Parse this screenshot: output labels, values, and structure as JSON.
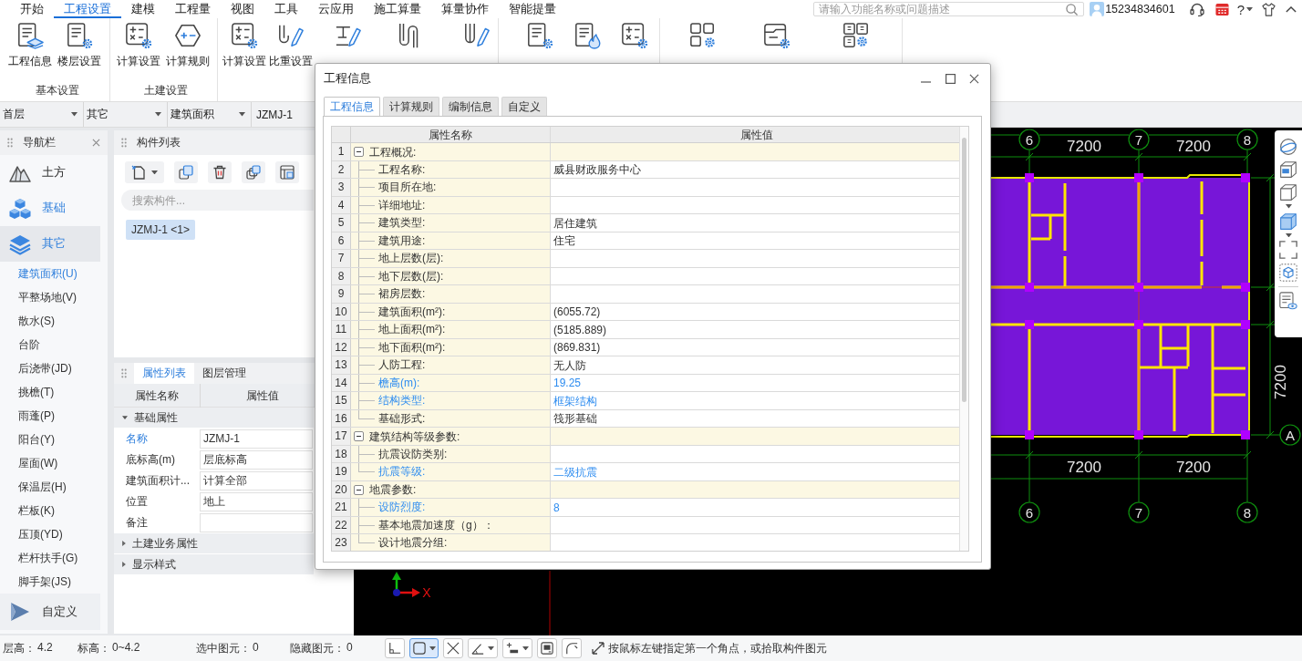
{
  "menu": {
    "tabs": [
      {
        "label": "开始",
        "selected": false
      },
      {
        "label": "工程设置",
        "selected": true
      },
      {
        "label": "建模",
        "selected": false
      },
      {
        "label": "工程量",
        "selected": false
      },
      {
        "label": "视图",
        "selected": false
      },
      {
        "label": "工具",
        "selected": false
      },
      {
        "label": "云应用",
        "selected": false
      },
      {
        "label": "施工算量",
        "selected": false
      },
      {
        "label": "算量协作",
        "selected": false
      },
      {
        "label": "智能提量",
        "selected": false
      }
    ],
    "search": {
      "placeholder": "请输入功能名称或问题描述"
    },
    "user": "15234834601",
    "help": "?"
  },
  "ribbon": {
    "groups": [
      {
        "label": "基本设置",
        "buttons": [
          "工程信息",
          "楼层设置"
        ]
      },
      {
        "label": "土建设置",
        "buttons": [
          "计算设置",
          "计算规则"
        ]
      },
      {
        "buttons": [
          "计算设置",
          "比重设置"
        ]
      }
    ]
  },
  "selectors": [
    "首层",
    "其它",
    "建筑面积"
  ],
  "current_component": "JZMJ-1",
  "navigation": {
    "title": "导航栏",
    "categories": [
      {
        "label": "土方",
        "selected": false,
        "hovered": false
      },
      {
        "label": "基础",
        "selected": false,
        "hovered": true
      },
      {
        "label": "其它",
        "selected": true,
        "hovered": false,
        "children": [
          {
            "label": "建筑面积(U)",
            "selected": true
          },
          {
            "label": "平整场地(V)",
            "selected": false
          },
          {
            "label": "散水(S)",
            "selected": false
          },
          {
            "label": "台阶",
            "selected": false
          },
          {
            "label": "后浇带(JD)",
            "selected": false
          },
          {
            "label": "挑檐(T)",
            "selected": false
          },
          {
            "label": "雨蓬(P)",
            "selected": false
          },
          {
            "label": "阳台(Y)",
            "selected": false
          },
          {
            "label": "屋面(W)",
            "selected": false
          },
          {
            "label": "保温层(H)",
            "selected": false
          },
          {
            "label": "栏板(K)",
            "selected": false
          },
          {
            "label": "压顶(YD)",
            "selected": false
          },
          {
            "label": "栏杆扶手(G)",
            "selected": false
          },
          {
            "label": "脚手架(JS)",
            "selected": false
          }
        ]
      }
    ],
    "custom": "自定义"
  },
  "components": {
    "title": "构件列表",
    "search": {
      "placeholder": "搜索构件..."
    },
    "items": [
      {
        "label": "JZMJ-1 <1>",
        "selected": true
      }
    ]
  },
  "properties": {
    "tabs": [
      {
        "label": "属性列表",
        "selected": true
      },
      {
        "label": "图层管理",
        "selected": false
      }
    ],
    "columns": [
      "属性名称",
      "属性值"
    ],
    "groups": [
      {
        "label": "基础属性",
        "expanded": true,
        "rows": [
          {
            "name": "名称",
            "value": "JZMJ-1",
            "highlighted": true
          },
          {
            "name": "底标高(m)",
            "value": "层底标高",
            "highlighted": false
          },
          {
            "name": "建筑面积计...",
            "value": "计算全部",
            "highlighted": false
          },
          {
            "name": "位置",
            "value": "地上",
            "highlighted": false
          },
          {
            "name": "备注",
            "highlighted": false
          }
        ]
      },
      {
        "label": "土建业务属性",
        "expanded": false
      },
      {
        "label": "显示样式",
        "expanded": false
      }
    ]
  },
  "dialog": {
    "title": "工程信息",
    "tabs": [
      {
        "label": "工程信息",
        "selected": true
      },
      {
        "label": "计算规则",
        "selected": false
      },
      {
        "label": "编制信息",
        "selected": false
      },
      {
        "label": "自定义",
        "selected": false
      }
    ],
    "columns": [
      "属性名称",
      "属性值"
    ],
    "groups": [
      {
        "number": "1",
        "name": "工程概况:",
        "expanded": true,
        "children": [
          {
            "number": "2",
            "name": "工程名称:",
            "value": "威县财政服务中心",
            "highlighted": false
          },
          {
            "number": "3",
            "name": "项目所在地:",
            "highlighted": false
          },
          {
            "number": "4",
            "name": "详细地址:",
            "highlighted": false
          },
          {
            "number": "5",
            "name": "建筑类型:",
            "value": "居住建筑",
            "highlighted": false
          },
          {
            "number": "6",
            "name": "建筑用途:",
            "value": "住宅",
            "highlighted": false
          },
          {
            "number": "7",
            "name": "地上层数(层):",
            "highlighted": false
          },
          {
            "number": "8",
            "name": "地下层数(层):",
            "highlighted": false
          },
          {
            "number": "9",
            "name": "裙房层数:",
            "highlighted": false
          },
          {
            "number": "10",
            "name": "建筑面积(m²):",
            "value": "(6055.72)",
            "highlighted": false
          },
          {
            "number": "11",
            "name": "地上面积(m²):",
            "value": "(5185.889)",
            "highlighted": false
          },
          {
            "number": "12",
            "name": "地下面积(m²):",
            "value": "(869.831)",
            "highlighted": false
          },
          {
            "number": "13",
            "name": "人防工程:",
            "value": "无人防",
            "highlighted": false
          },
          {
            "number": "14",
            "name": "檐高(m):",
            "value": "19.25",
            "highlighted": true
          },
          {
            "number": "15",
            "name": "结构类型:",
            "value": "框架结构",
            "highlighted": true
          },
          {
            "number": "16",
            "name": "基础形式:",
            "value": "筏形基础",
            "highlighted": false
          }
        ]
      },
      {
        "number": "17",
        "name": "建筑结构等级参数:",
        "expanded": true,
        "children": [
          {
            "number": "18",
            "name": "抗震设防类别:",
            "highlighted": false
          },
          {
            "number": "19",
            "name": "抗震等级:",
            "value": "二级抗震",
            "highlighted": true
          }
        ]
      },
      {
        "number": "20",
        "name": "地震参数:",
        "expanded": true,
        "children": [
          {
            "number": "21",
            "name": "设防烈度:",
            "value": "8",
            "highlighted": true
          },
          {
            "number": "22",
            "name": "基本地震加速度（g）：",
            "highlighted": false
          },
          {
            "number": "23",
            "name": "设计地震分组:",
            "highlighted": false
          }
        ]
      }
    ]
  },
  "canvas": {
    "top_axes": [
      "6",
      "7",
      "8"
    ],
    "top_dimensions": [
      "7200",
      "7200"
    ],
    "side_dimension": "7200",
    "side_axis": "A",
    "bottom_dimensions": [
      "7200",
      "7200"
    ],
    "bottom_axes": [
      "6",
      "7",
      "8"
    ],
    "origin_label": "X"
  },
  "status_bar": {
    "fields": [
      {
        "label": "层高：",
        "value": "4.2"
      },
      {
        "label": "标高：",
        "value": "0~4.2"
      },
      {
        "label": "选中图元：",
        "value": "0"
      },
      {
        "label": "隐藏图元：",
        "value": "0"
      }
    ],
    "tools": [
      {
        "selected": false
      },
      {
        "selected": true
      },
      {
        "selected": false
      },
      {
        "selected": false
      },
      {
        "selected": false
      },
      {
        "selected": false
      },
      {
        "selected": false
      }
    ],
    "hint": "按鼠标左键指定第一个角点，或拾取构件图元"
  }
}
